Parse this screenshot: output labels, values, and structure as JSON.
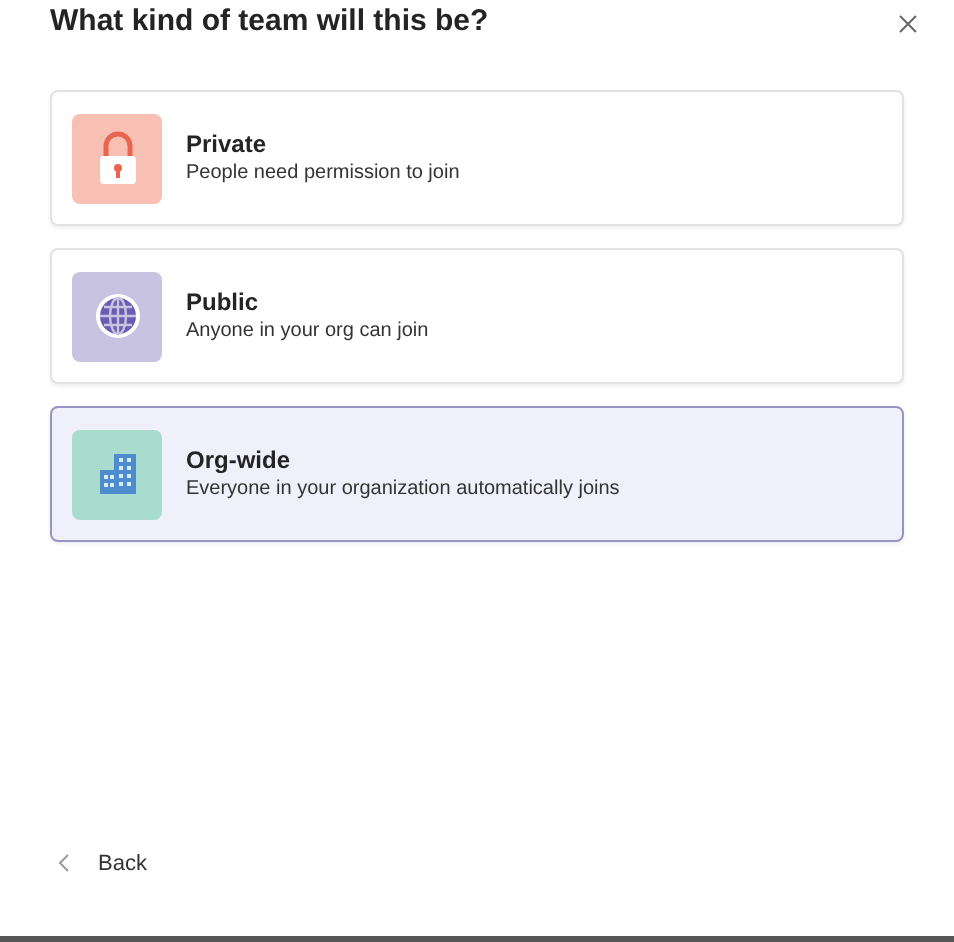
{
  "dialog": {
    "title": "What kind of team will this be?"
  },
  "options": [
    {
      "kind": "lock",
      "title": "Private",
      "description": "People need permission to join",
      "selected": false
    },
    {
      "kind": "globe",
      "title": "Public",
      "description": "Anyone in your org can join",
      "selected": false
    },
    {
      "kind": "building",
      "title": "Org-wide",
      "description": "Everyone in your organization automatically joins",
      "selected": true
    }
  ],
  "back": {
    "label": "Back"
  }
}
